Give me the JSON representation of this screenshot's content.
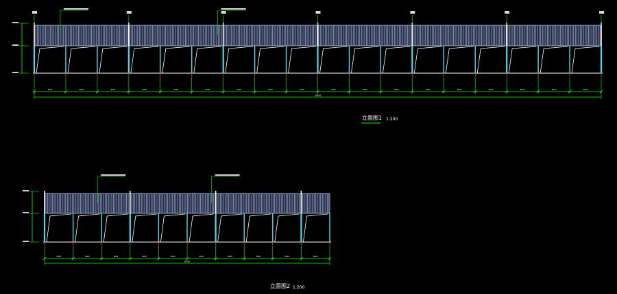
{
  "drawing": {
    "background": "#000000",
    "colors": {
      "cladding": "#aebfe8",
      "cladding_fill": "#6c82c4",
      "column": "#40e0f0",
      "rafter": "#ffffff",
      "dimension": "#00ff00",
      "ground": "#ffffff",
      "anchor": "#ff2020",
      "label": "#ffffff"
    }
  },
  "elevations": [
    {
      "id": "elevation-1",
      "title": "立面图1",
      "scale": "1:200",
      "bays": 18,
      "major_every": 3,
      "bay_dimension": "6000",
      "total_dimension": "108000",
      "grid_count": 19
    },
    {
      "id": "elevation-2",
      "title": "立面图2",
      "scale": "1:200",
      "bays": 10,
      "major_every": 3,
      "bay_dimension": "6000",
      "total_dimension": "60000",
      "grid_count": 11
    }
  ]
}
